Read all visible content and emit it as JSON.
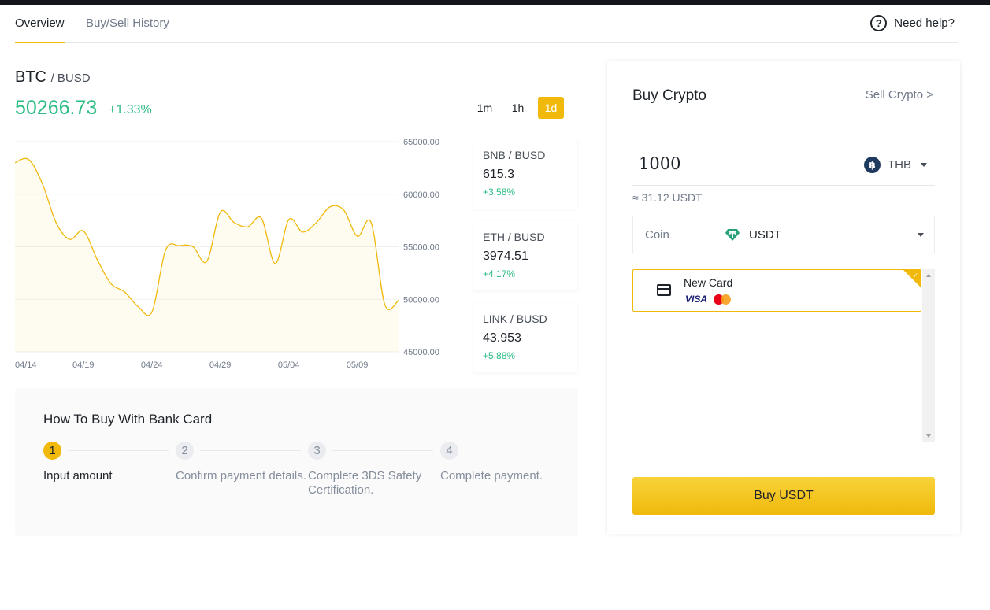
{
  "tabs": [
    {
      "label": "Overview",
      "active": true
    },
    {
      "label": "Buy/Sell History",
      "active": false
    }
  ],
  "help_label": "Need help?",
  "market": {
    "base": "BTC",
    "quote": "/ BUSD",
    "price": "50266.73",
    "change": "+1.33%",
    "ranges": [
      "1m",
      "1h",
      "1d"
    ],
    "active_range": "1d"
  },
  "chart_data": {
    "type": "area",
    "x": [
      "04/14",
      "04/15",
      "04/16",
      "04/17",
      "04/18",
      "04/19",
      "04/20",
      "04/21",
      "04/22",
      "04/23",
      "04/24",
      "04/25",
      "04/26",
      "04/27",
      "04/28",
      "04/29",
      "04/30",
      "05/01",
      "05/02",
      "05/03",
      "05/04",
      "05/05",
      "05/06",
      "05/07",
      "05/08",
      "05/09",
      "05/10",
      "05/11",
      "05/12"
    ],
    "series": [
      {
        "values": [
          63000,
          63300,
          61000,
          57300,
          55700,
          56500,
          53800,
          51500,
          50700,
          49300,
          48800,
          54700,
          55100,
          55000,
          53600,
          58300,
          57300,
          56900,
          57700,
          53400,
          57600,
          56400,
          57300,
          58800,
          58500,
          56000,
          57300,
          49500,
          49900
        ]
      }
    ],
    "x_ticks": [
      "04/14",
      "04/19",
      "04/24",
      "04/29",
      "05/04",
      "05/09"
    ],
    "y_ticks": [
      "65000.00",
      "60000.00",
      "55000.00",
      "50000.00",
      "45000.00"
    ],
    "ylim": [
      45000,
      65000
    ],
    "grid": true,
    "color": "#f0b90b"
  },
  "tickers": [
    {
      "name": "BNB / BUSD",
      "price": "615.3",
      "change": "+3.58%"
    },
    {
      "name": "ETH / BUSD",
      "price": "3974.51",
      "change": "+4.17%"
    },
    {
      "name": "LINK / BUSD",
      "price": "43.953",
      "change": "+5.88%"
    }
  ],
  "howto": {
    "title": "How To Buy With Bank Card",
    "steps": [
      {
        "num": "1",
        "text": "Input amount",
        "active": true
      },
      {
        "num": "2",
        "text": "Confirm payment details.",
        "active": false
      },
      {
        "num": "3",
        "text": "Complete 3DS Safety Certification.",
        "active": false
      },
      {
        "num": "4",
        "text": "Complete payment.",
        "active": false
      }
    ]
  },
  "buy_panel": {
    "title": "Buy Crypto",
    "sell_link": "Sell Crypto >",
    "amount": "1000",
    "fiat": "THB",
    "fiat_icon": "baht-coin-icon",
    "approx": "≈ 31.12 USDT",
    "coin_label": "Coin",
    "coin": "USDT",
    "coin_icon": "tether-icon",
    "card_name": "New Card",
    "card_brands": [
      "VISA",
      "mastercard"
    ],
    "buy_button": "Buy USDT"
  },
  "colors": {
    "accent": "#f0b90b",
    "positive": "#2ebd85",
    "text": "#1e2329",
    "muted": "#707a8a"
  }
}
